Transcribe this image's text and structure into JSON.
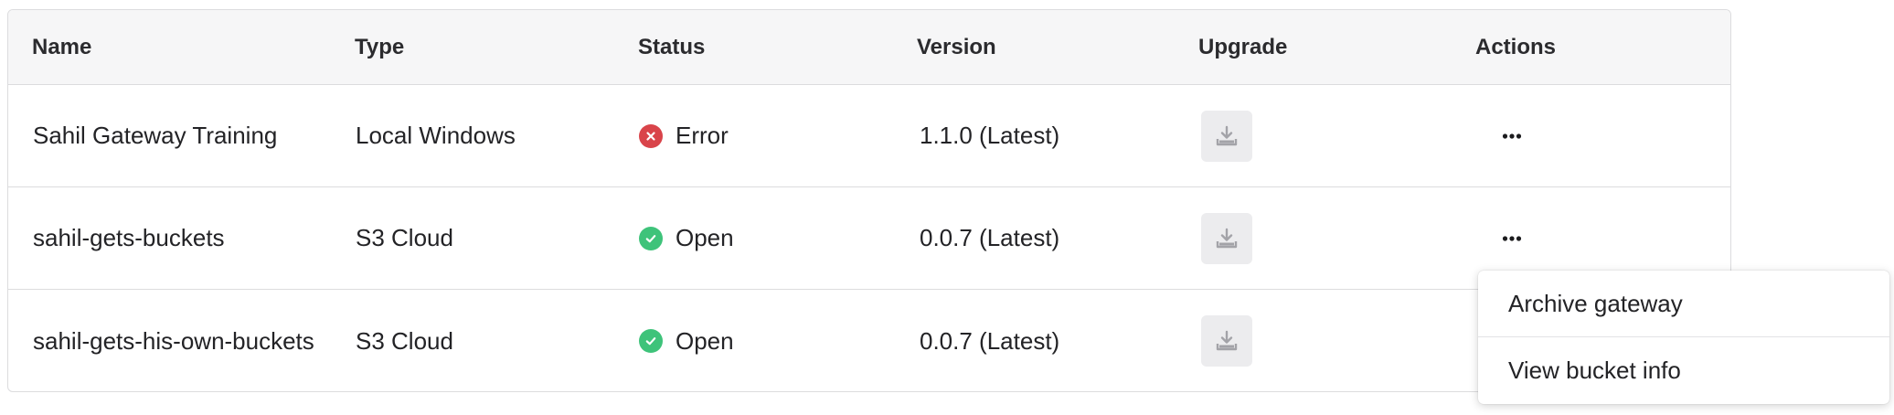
{
  "table": {
    "headers": {
      "name": "Name",
      "type": "Type",
      "status": "Status",
      "version": "Version",
      "upgrade": "Upgrade",
      "actions": "Actions"
    },
    "rows": [
      {
        "name": "Sahil Gateway Training",
        "type": "Local Windows",
        "status": "Error",
        "status_icon": "error-x-icon",
        "version": "1.1.0 (Latest)"
      },
      {
        "name": "sahil-gets-buckets",
        "type": "S3 Cloud",
        "status": "Open",
        "status_icon": "check-icon",
        "version": "0.0.7 (Latest)"
      },
      {
        "name": "sahil-gets-his-own-buckets",
        "type": "S3 Cloud",
        "status": "Open",
        "status_icon": "check-icon",
        "version": "0.0.7 (Latest)"
      }
    ]
  },
  "actions_menu": {
    "items": [
      {
        "label": "Archive gateway"
      },
      {
        "label": "View bucket info"
      }
    ]
  },
  "icons": {
    "upgrade": "download-icon",
    "actions": "more-horizontal-icon"
  },
  "colors": {
    "error": "#d9444a",
    "success": "#3ec37a",
    "header_bg": "#f6f6f7",
    "border": "#dcdcde",
    "upgrade_btn_bg": "#ececee"
  }
}
